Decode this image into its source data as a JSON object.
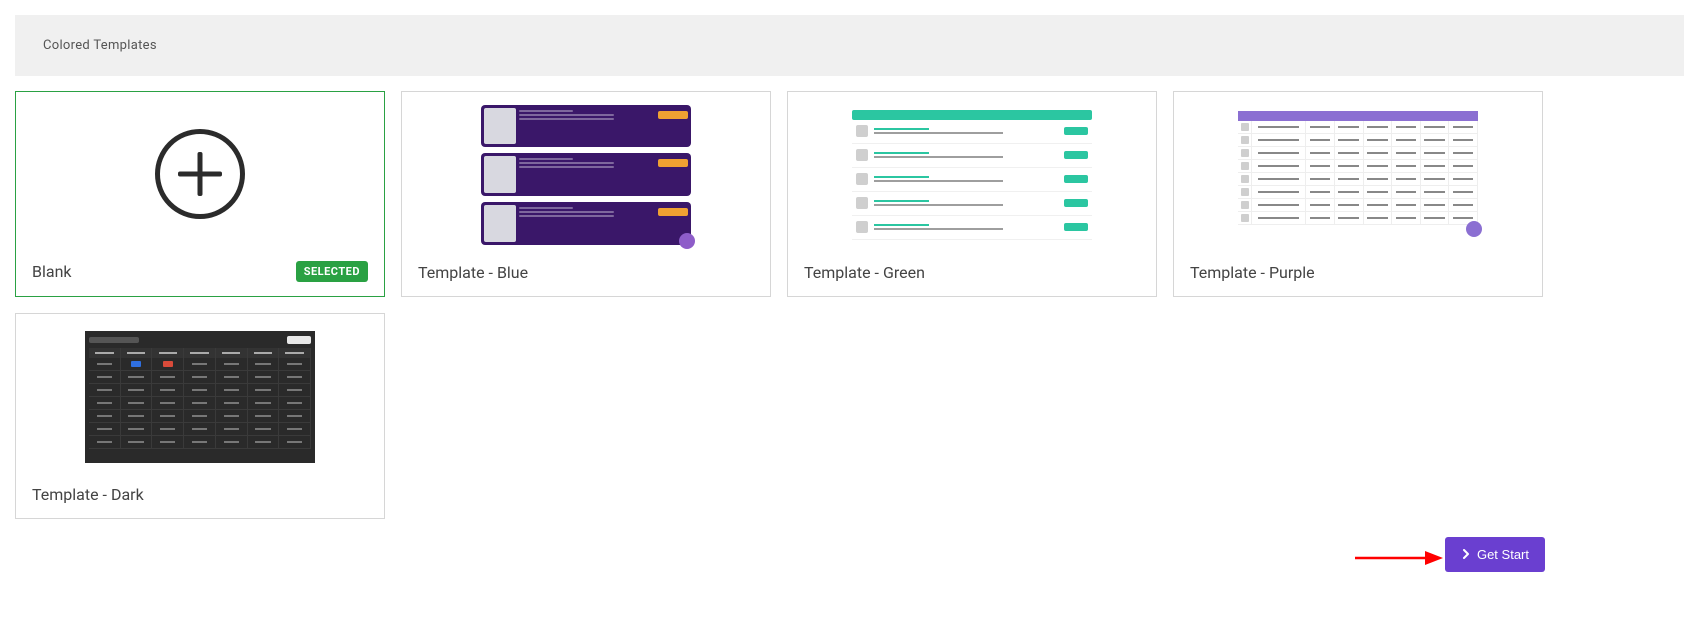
{
  "section": {
    "title": "Colored Templates"
  },
  "templates": [
    {
      "label": "Blank",
      "selected": true,
      "selected_badge": "SELECTED",
      "preview_kind": "blank"
    },
    {
      "label": "Template - Blue",
      "selected": false,
      "preview_kind": "blue"
    },
    {
      "label": "Template - Green",
      "selected": false,
      "preview_kind": "green"
    },
    {
      "label": "Template - Purple",
      "selected": false,
      "preview_kind": "purple"
    },
    {
      "label": "Template - Dark",
      "selected": false,
      "preview_kind": "dark"
    }
  ],
  "footer": {
    "get_start_label": "Get Start"
  },
  "colors": {
    "accent_purple": "#6a3fd0",
    "selected_green": "#2aa143",
    "preview_blue_bg": "#3a1769",
    "preview_green_accent": "#2bc6a1",
    "preview_purple_accent": "#8b6fd2",
    "preview_dark_bg": "#2a2a2a"
  }
}
